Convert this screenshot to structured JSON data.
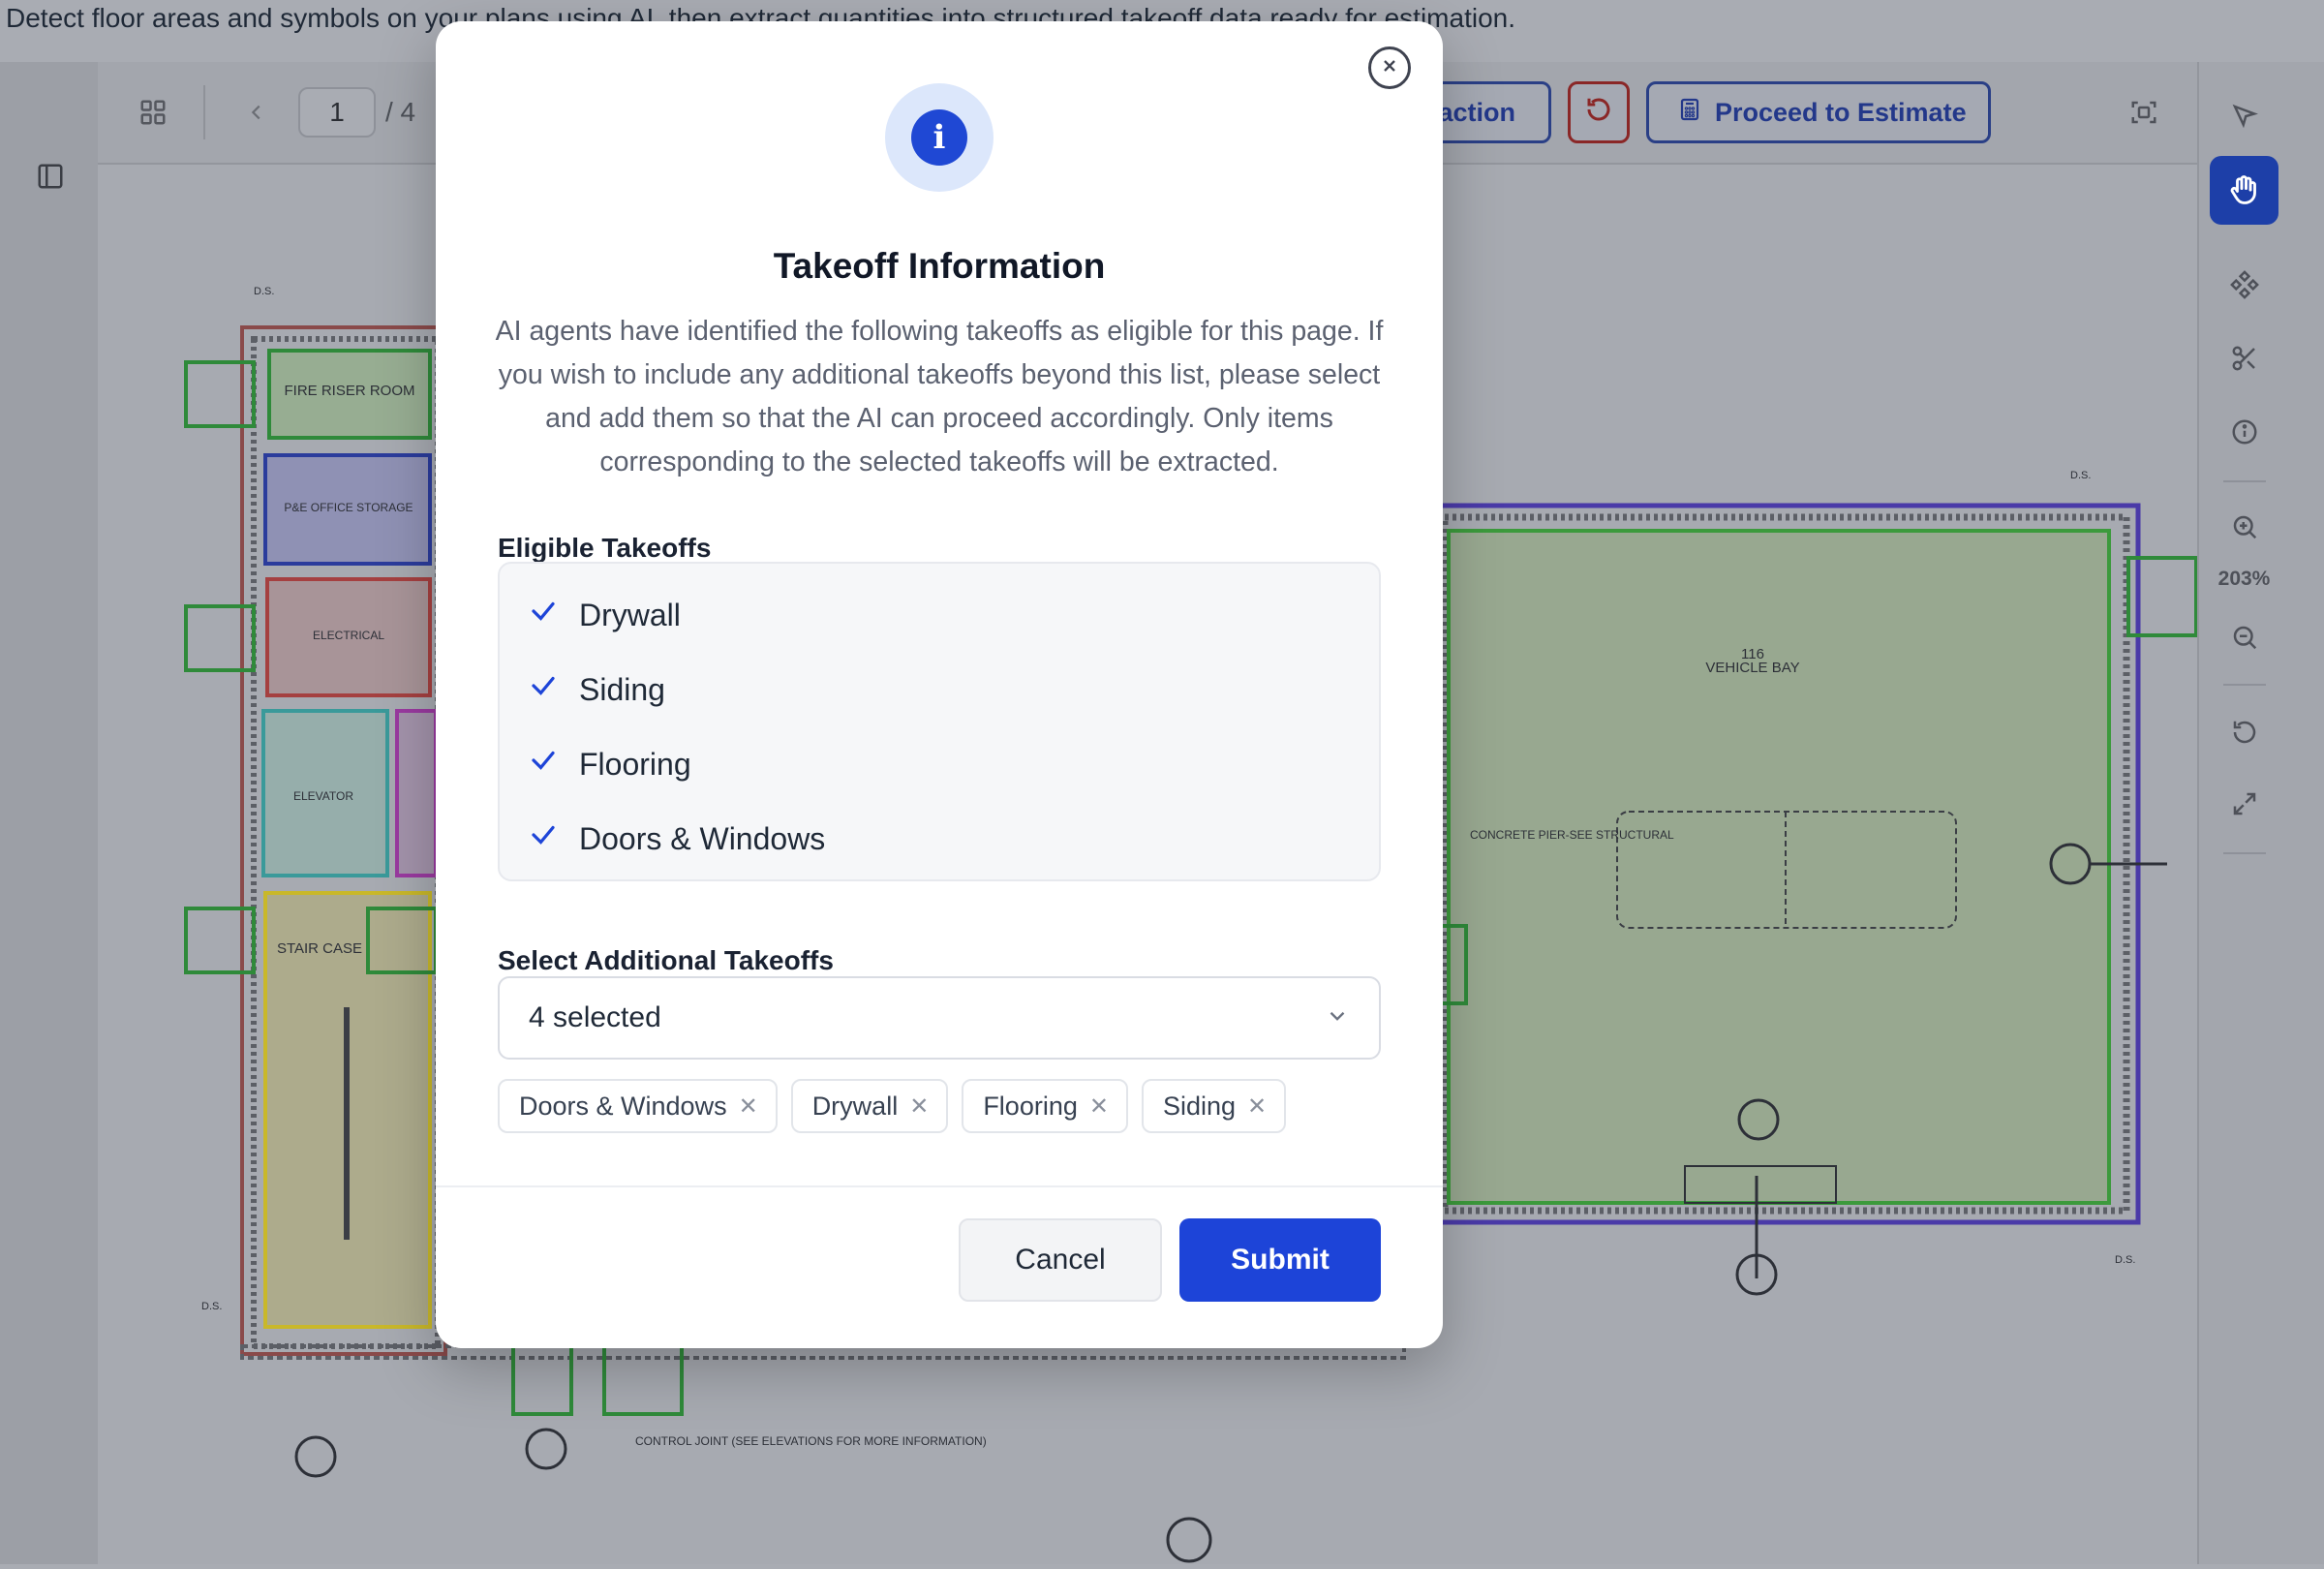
{
  "header": {
    "description": "Detect floor areas and symbols on your plans using AI, then extract quantities into structured takeoff data ready for estimation."
  },
  "toolbar": {
    "page_number": "1",
    "page_total": "/ 4",
    "extraction_button_label_visible": "action",
    "proceed_button_label": "Proceed to Estimate"
  },
  "right_toolbar": {
    "zoom_level": "203%",
    "active_tool": "hand-tool"
  },
  "plan_labels": {
    "room_101": "FIRE RISER ROOM",
    "room_102": "P&E OFFICE STORAGE",
    "room_103": "ELECTRICAL",
    "elevator": "ELEVATOR",
    "stair": "STAIR CASE",
    "vehicle_bay_num": "116",
    "vehicle_bay": "VEHICLE BAY",
    "concrete_note": "CONCRETE PIER-SEE STRUCTURAL",
    "control_joint": "CONTROL JOINT (SEE ELEVATIONS FOR MORE INFORMATION)",
    "ds": "D.S."
  },
  "modal": {
    "title": "Takeoff Information",
    "description": "AI agents have identified the following takeoffs as eligible for this page. If you wish to include any additional takeoffs beyond this list, please select and add them so that the AI can proceed accordingly. Only items corresponding to the selected takeoffs will be extracted.",
    "eligible_label": "Eligible Takeoffs",
    "eligible_items": [
      "Drywall",
      "Siding",
      "Flooring",
      "Doors & Windows"
    ],
    "additional_label": "Select Additional Takeoffs",
    "select_value": "4 selected",
    "chips": [
      "Doors & Windows",
      "Drywall",
      "Flooring",
      "Siding"
    ],
    "cancel_label": "Cancel",
    "submit_label": "Submit"
  }
}
